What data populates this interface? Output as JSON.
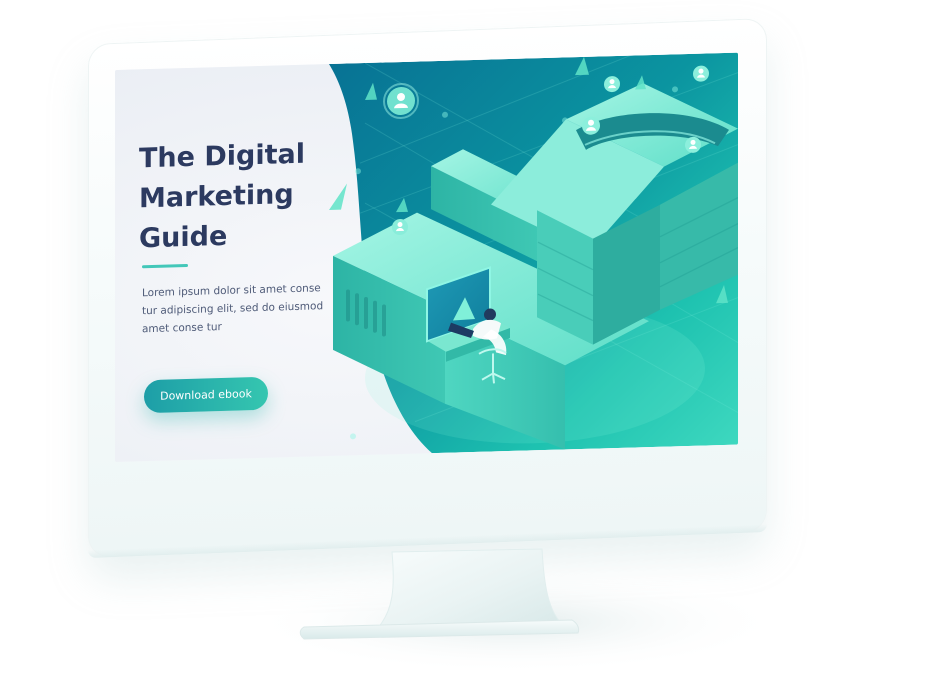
{
  "hero": {
    "title": "The Digital\nMarketing\nGuide",
    "body": "Lorem ipsum dolor sit amet conse tur adipiscing elit, sed do eiusmod amet conse tur",
    "cta_label": "Download ebook"
  },
  "colors": {
    "title": "#2c3a60",
    "accent": "#43c7b9",
    "button_start": "#1d9ea7",
    "button_end": "#35c6b0",
    "illustration_bg": "#087a96",
    "building_light": "#79edd2",
    "building_dark": "#27b6a5"
  },
  "icons": [
    "user-icon",
    "monitor-icon",
    "triangle-icon",
    "office-chair-icon"
  ]
}
